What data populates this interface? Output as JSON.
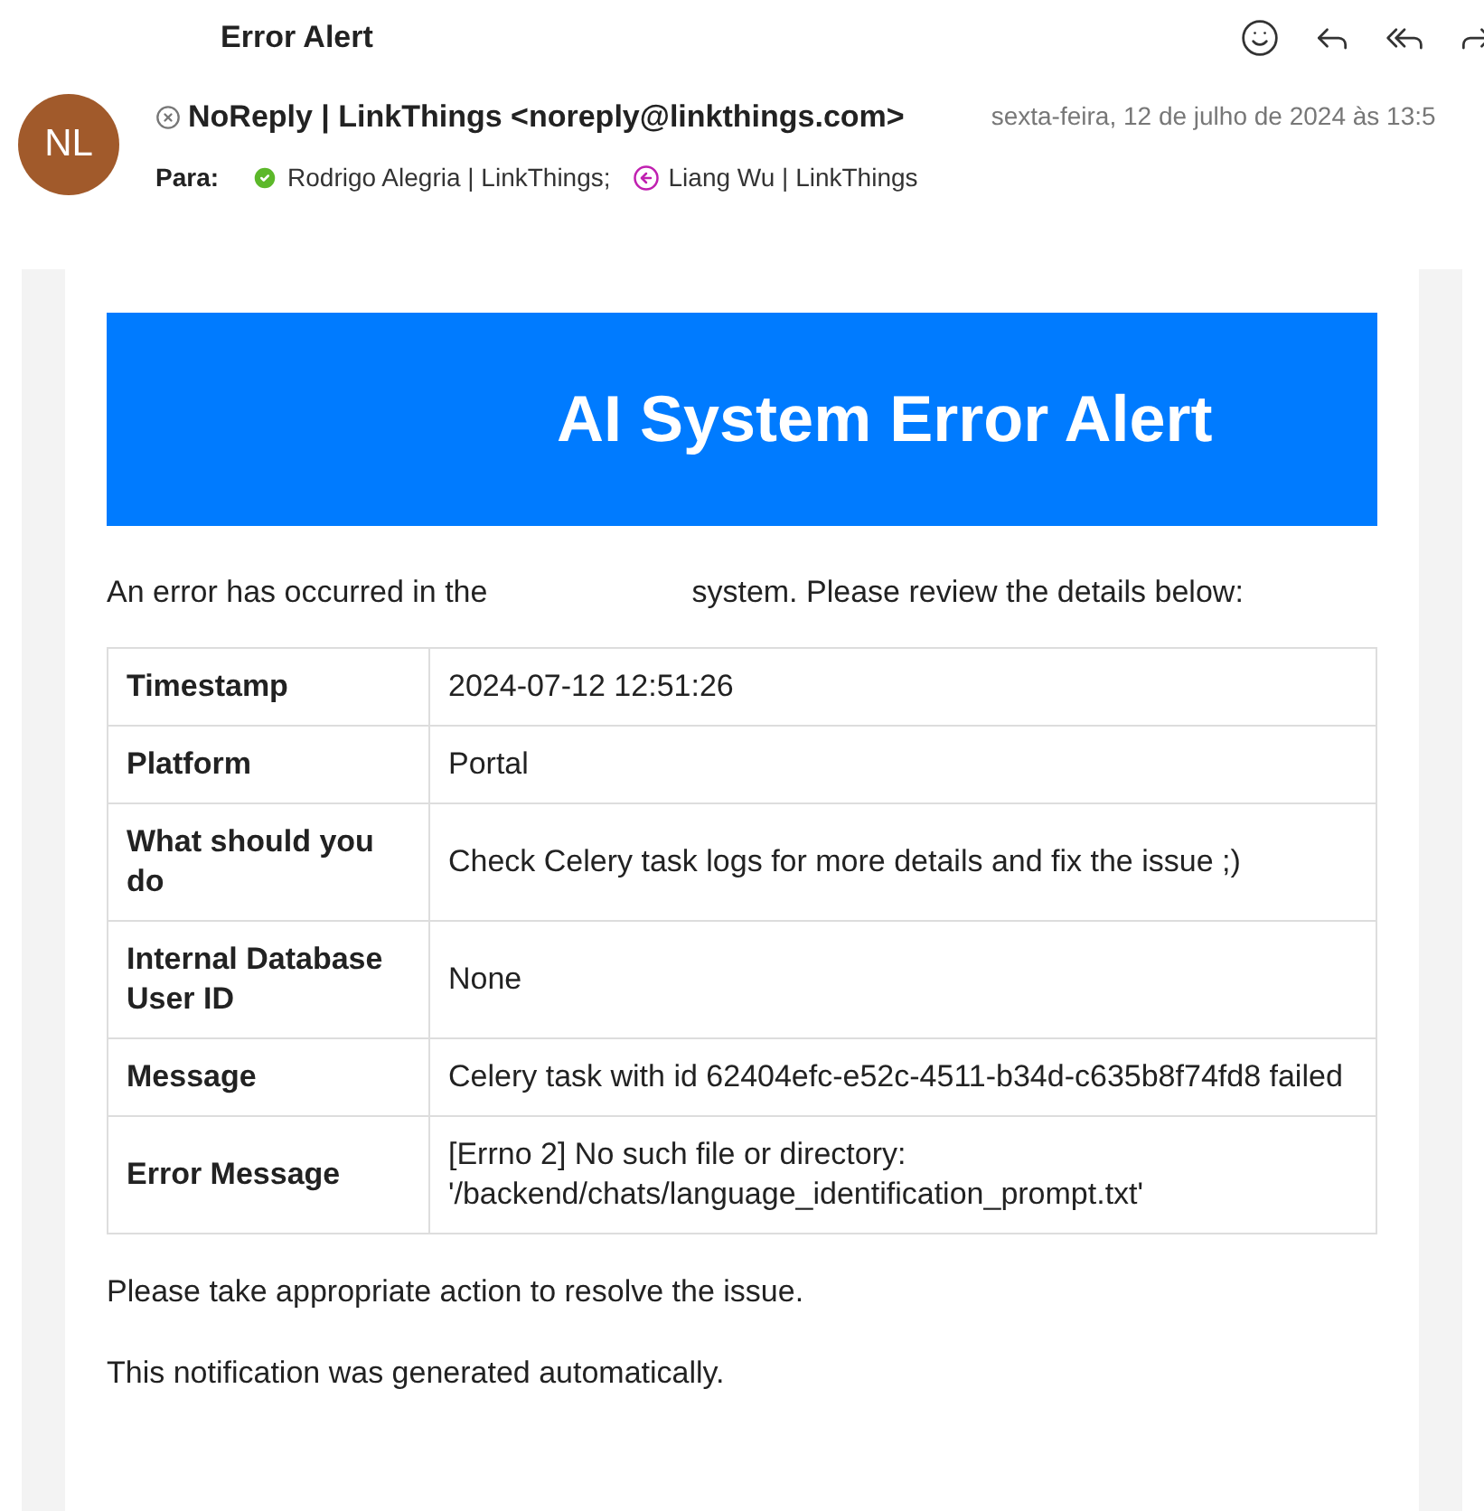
{
  "subject": "Error Alert",
  "toolbar": [
    {
      "kind": "emoji"
    },
    {
      "kind": "reply"
    },
    {
      "kind": "reply-all"
    },
    {
      "kind": "forward"
    }
  ],
  "sender": {
    "initials": "NL",
    "name": "NoReply | LinkThings <noreply@linkthings.com>",
    "date": "sexta-feira, 12 de julho de 2024 às 13:5"
  },
  "to_label": "Para:",
  "recipients": [
    {
      "name": "Rodrigo Alegria | LinkThings;",
      "kind": "accepted",
      "color": "#5cb82a"
    },
    {
      "name": "Liang Wu | LinkThings",
      "kind": "tentative",
      "color": "#c020b0"
    }
  ],
  "body": {
    "banner": "AI System Error Alert",
    "intro": [
      "An error has occurred in the",
      "system. Please review the details below:"
    ],
    "table": [
      {
        "label": "Timestamp",
        "value": "2024-07-12 12:51:26"
      },
      {
        "label": "Platform",
        "value": "Portal"
      },
      {
        "label": "What should you do",
        "value": "Check Celery task logs for more details and fix the issue ;)"
      },
      {
        "label": "Internal Database User ID",
        "value": "None"
      },
      {
        "label": "Message",
        "value": "Celery task with id 62404efc-e52c-4511-b34d-c635b8f74fd8 failed"
      },
      {
        "label": "Error Message",
        "value": "[Errno 2] No such file or directory: '/backend/chats/language_identification_prompt.txt'"
      }
    ],
    "footer": [
      "Please take appropriate action to resolve the issue.",
      "This notification was generated automatically."
    ]
  }
}
